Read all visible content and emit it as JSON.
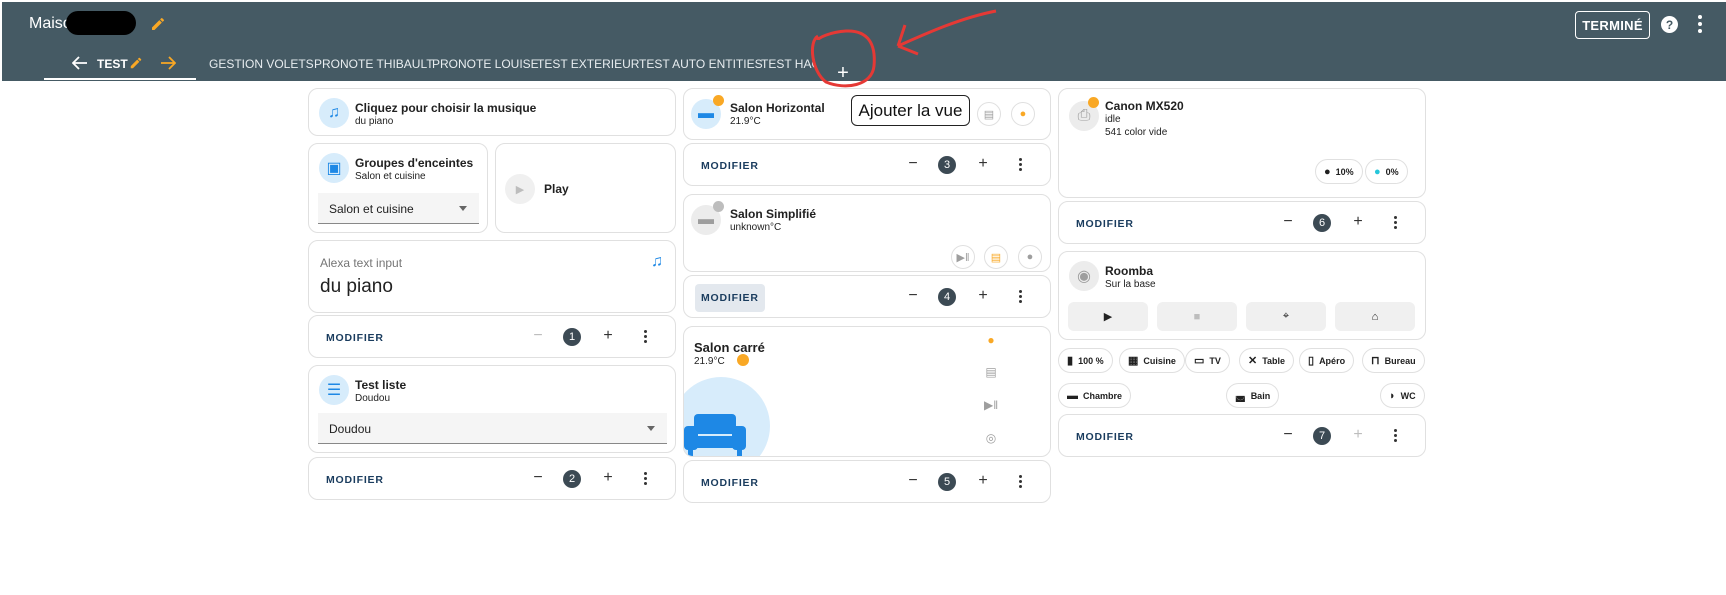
{
  "header": {
    "title": "Maison",
    "done_label": "TERMINÉ",
    "help_glyph": "?",
    "add_view_glyph": "+",
    "tooltip": "Ajouter la vue"
  },
  "tabs": [
    {
      "label": "TEST"
    },
    {
      "label": "GESTION VOLETS"
    },
    {
      "label": "PRONOTE THIBAULT"
    },
    {
      "label": "PRONOTE LOUISE"
    },
    {
      "label": "TEST EXTERIEUR"
    },
    {
      "label": "TEST AUTO ENTITIES"
    },
    {
      "label": "TEST HACI"
    }
  ],
  "col1": {
    "music": {
      "name": "Cliquez pour choisir la musique",
      "sub": "du piano"
    },
    "groups": {
      "name": "Groupes d'enceintes",
      "sub": "Salon et cuisine",
      "select_value": "Salon et cuisine"
    },
    "play": {
      "label": "Play"
    },
    "alexa": {
      "label": "Alexa text input",
      "value": "du piano"
    },
    "modify1": {
      "label": "MODIFIER",
      "badge": "1",
      "minus": "−",
      "plus": "+"
    },
    "list": {
      "name": "Test liste",
      "sub": "Doudou",
      "select_value": "Doudou"
    },
    "modify2": {
      "label": "MODIFIER",
      "badge": "2",
      "minus": "−",
      "plus": "+"
    }
  },
  "col2": {
    "horizontal": {
      "name": "Salon Horizontal",
      "sub": "21.9°C"
    },
    "modify3": {
      "label": "MODIFIER",
      "badge": "3",
      "minus": "−",
      "plus": "+"
    },
    "simplified": {
      "name": "Salon Simplifié",
      "sub": "unknown°C"
    },
    "modify4": {
      "label": "MODIFIER",
      "badge": "4",
      "minus": "−",
      "plus": "+"
    },
    "square": {
      "name": "Salon carré",
      "sub": "21.9°C"
    },
    "modify5": {
      "label": "MODIFIER",
      "badge": "5",
      "minus": "−",
      "plus": "+"
    }
  },
  "col3": {
    "printer": {
      "name": "Canon MX520",
      "state": "idle",
      "sub": "541 color vide",
      "ink_black": "10%",
      "ink_cyan": "0%"
    },
    "modify6": {
      "label": "MODIFIER",
      "badge": "6",
      "minus": "−",
      "plus": "+"
    },
    "roomba": {
      "name": "Roomba",
      "sub": "Sur la base"
    },
    "chips": [
      {
        "label": "100 %",
        "icon": "battery-icon"
      },
      {
        "label": "Cuisine",
        "icon": "kitchen-icon"
      },
      {
        "label": "TV",
        "icon": "tv-icon"
      },
      {
        "label": "Table",
        "icon": "utensils-icon"
      },
      {
        "label": "Apéro",
        "icon": "glass-icon"
      },
      {
        "label": "Bureau",
        "icon": "desk-icon"
      },
      {
        "label": "Chambre",
        "icon": "bed-icon"
      },
      {
        "label": "Bain",
        "icon": "bath-icon"
      },
      {
        "label": "WC",
        "icon": "toilet-icon"
      }
    ],
    "modify7": {
      "label": "MODIFIER",
      "badge": "7",
      "minus": "−",
      "plus": "+"
    }
  },
  "colors": {
    "header_bg": "#455a64",
    "accent_orange": "#f9a825",
    "icon_blue": "#1e88e5",
    "annotation_red": "#e53935"
  }
}
